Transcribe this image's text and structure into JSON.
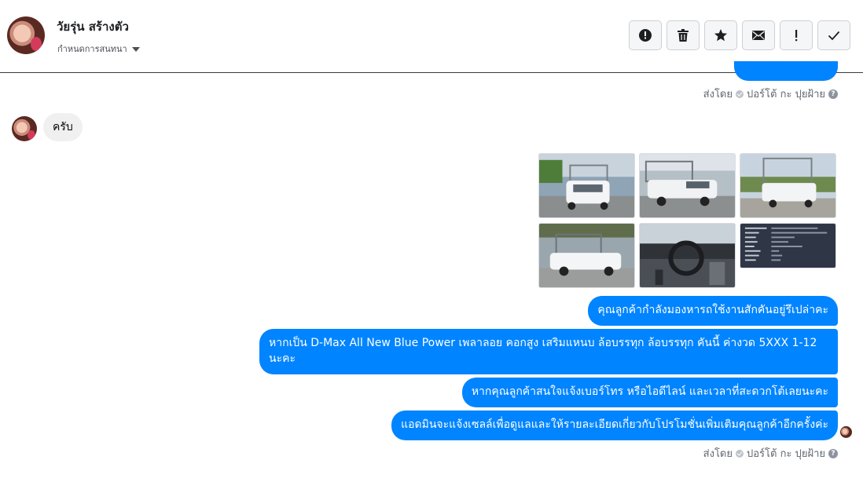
{
  "header": {
    "contact_name": "วัยรุ่น สร้างตัว",
    "conversation_settings_label": "กำหนดการสนทนา",
    "toolbar": [
      {
        "name": "report-button",
        "icon": "alert-circle-icon"
      },
      {
        "name": "delete-button",
        "icon": "trash-icon"
      },
      {
        "name": "star-button",
        "icon": "star-icon"
      },
      {
        "name": "mark-unread-button",
        "icon": "envelope-icon"
      },
      {
        "name": "spam-button",
        "icon": "exclamation-icon"
      },
      {
        "name": "mark-done-button",
        "icon": "check-icon"
      }
    ]
  },
  "thread": {
    "sent_by_1": {
      "prefix": "ส่งโดย",
      "agent": "ปอร์โต้ กะ ปุยฝ้าย"
    },
    "received_message": "ครับ",
    "photos": [
      {
        "name": "photo-truck-front"
      },
      {
        "name": "photo-truck-side"
      },
      {
        "name": "photo-truck-rear"
      },
      {
        "name": "photo-truck-profile"
      },
      {
        "name": "photo-truck-interior"
      },
      {
        "name": "photo-spec-sheet"
      }
    ],
    "sent_messages": [
      "คุณลูกค้ากำลังมองหารถใช้งานสักคันอยู่รึเปล่าคะ",
      "หากเป็น D-Max All New Blue Power เพลาลอย คอกสูง เสริมแหนบ ล้อบรรทุก ล้อบรรทุก  คันนี้ ค่างวด 5XXX 1-12 นะคะ",
      "หากคุณลูกค้าสนใจแจ้งเบอร์โทร หรือไอดีไลน์  และเวลาที่สะดวกโต้เลยนะคะ",
      "แอดมินจะแจ้งเซลล์เพื่อดูแลและให้รายละเอียดเกี่ยวกับโปรโมชั่นเพิ่มเติมคุณลูกค้าอีกครั้งค่ะ"
    ],
    "sent_by_2": {
      "prefix": "ส่งโดย",
      "agent": "ปอร์โต้ กะ ปุยฝ้าย"
    }
  },
  "colors": {
    "sent_bubble": "#0084ff",
    "received_bubble": "#f1f0f0",
    "toolbar_bg": "#f5f6f7"
  }
}
